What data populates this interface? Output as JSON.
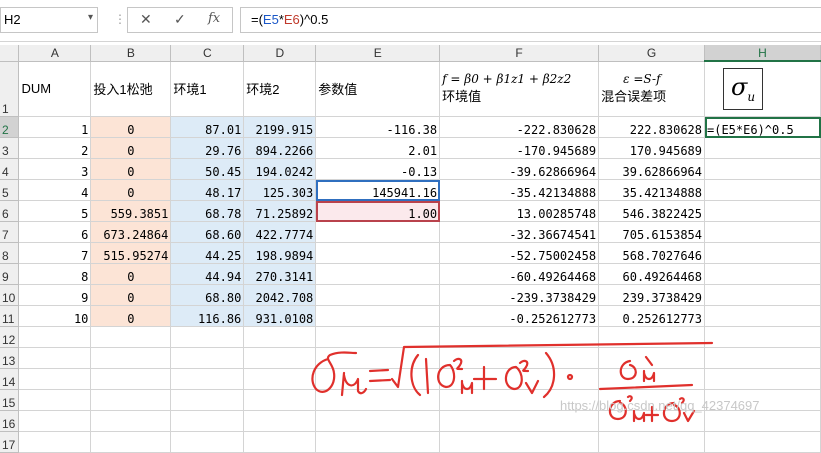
{
  "formula_bar": {
    "name_box": "H2",
    "cancel_icon": "✕",
    "enter_icon": "✓",
    "fx_icon": "fx",
    "formula_prefix": "=(",
    "ref1": "E5",
    "op": "*",
    "ref2": "E6",
    "formula_suffix": ")^0.5"
  },
  "columns": [
    "A",
    "B",
    "C",
    "D",
    "E",
    "F",
    "G",
    "H"
  ],
  "header_row": {
    "A": "DUM",
    "B": "投入1松弛",
    "C": "环境1",
    "D": "环境2",
    "E": "参数值",
    "F_formula": "f = β0 + β1z1 + β2z2",
    "F": "环境值",
    "G_formula": "ε =S-f",
    "G": "混合误差项",
    "H_symbol": "σ",
    "H_sub": "u"
  },
  "rows": [
    {
      "n": "2",
      "A": "1",
      "B": "0",
      "C": "87.01",
      "D": "2199.915",
      "E": "-116.38",
      "F": "-222.830628",
      "G": "222.830628",
      "H": "=(E5*E6)^0.5"
    },
    {
      "n": "3",
      "A": "2",
      "B": "0",
      "C": "29.76",
      "D": "894.2266",
      "E": "2.01",
      "F": "-170.945689",
      "G": "170.945689",
      "H": ""
    },
    {
      "n": "4",
      "A": "3",
      "B": "0",
      "C": "50.45",
      "D": "194.0242",
      "E": "-0.13",
      "F": "-39.62866964",
      "G": "39.62866964",
      "H": ""
    },
    {
      "n": "5",
      "A": "4",
      "B": "0",
      "C": "48.17",
      "D": "125.303",
      "E": "145941.16",
      "F": "-35.42134888",
      "G": "35.42134888",
      "H": ""
    },
    {
      "n": "6",
      "A": "5",
      "B": "559.3851",
      "C": "68.78",
      "D": "71.25892",
      "E": "1.00",
      "F": "13.00285748",
      "G": "546.3822425",
      "H": ""
    },
    {
      "n": "7",
      "A": "6",
      "B": "673.24864",
      "C": "68.60",
      "D": "422.7774",
      "E": "",
      "F": "-32.36674541",
      "G": "705.6153854",
      "H": ""
    },
    {
      "n": "8",
      "A": "7",
      "B": "515.95274",
      "C": "44.25",
      "D": "198.9894",
      "E": "",
      "F": "-52.75002458",
      "G": "568.7027646",
      "H": ""
    },
    {
      "n": "9",
      "A": "8",
      "B": "0",
      "C": "44.94",
      "D": "270.3141",
      "E": "",
      "F": "-60.49264468",
      "G": "60.49264468",
      "H": ""
    },
    {
      "n": "10",
      "A": "9",
      "B": "0",
      "C": "68.80",
      "D": "2042.708",
      "E": "",
      "F": "-239.3738429",
      "G": "239.3738429",
      "H": ""
    },
    {
      "n": "11",
      "A": "10",
      "B": "0",
      "C": "116.86",
      "D": "931.0108",
      "E": "",
      "F": "-0.252612773",
      "G": "0.252612773",
      "H": ""
    }
  ],
  "empty_rows": [
    "12",
    "13",
    "14",
    "15",
    "16",
    "17"
  ],
  "header_row_num": "1",
  "annotation_color": "#e0302c",
  "watermark": "https://blog.csdn.net/qq_42374697"
}
